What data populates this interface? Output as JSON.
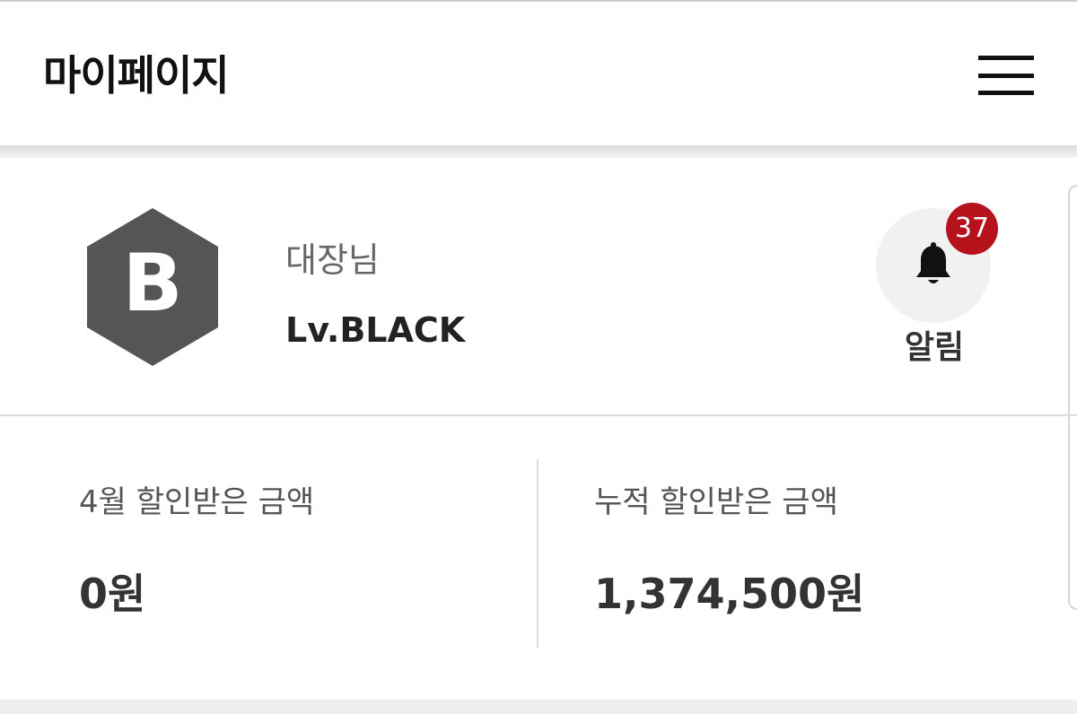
{
  "header": {
    "title": "마이페이지",
    "menu_icon": "hamburger-menu-icon"
  },
  "profile": {
    "badge_letter": "B",
    "badge_color": "#555555",
    "name": "대장님",
    "level": "Lv.BLACK"
  },
  "notifications": {
    "icon": "bell-icon",
    "count": "37",
    "count_color": "#b5121b",
    "label": "알림"
  },
  "stats": [
    {
      "label": "4월 할인받은 금액",
      "value": "0원"
    },
    {
      "label": "누적 할인받은 금액",
      "value": "1,374,500원"
    }
  ]
}
